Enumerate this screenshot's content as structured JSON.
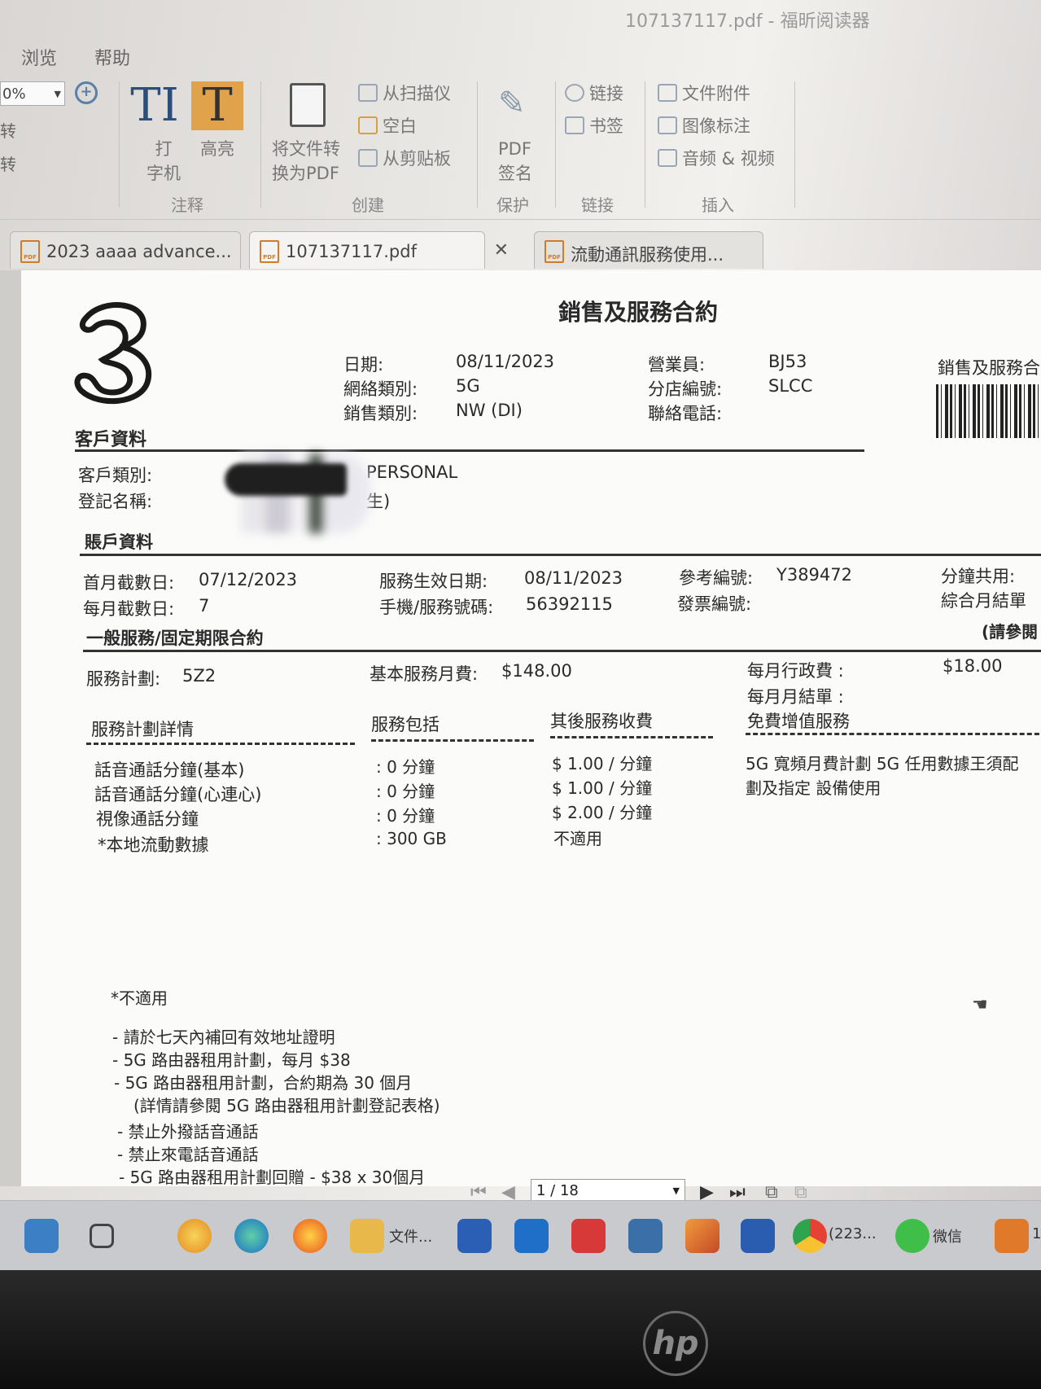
{
  "window": {
    "title": "107137117.pdf - 福昕阅读器"
  },
  "menu": {
    "items": [
      "浏览",
      "帮助"
    ]
  },
  "toolbar": {
    "zoom": "0%",
    "rotate_items": [
      "转",
      "转"
    ],
    "typewriter": [
      "打",
      "字机"
    ],
    "highlight": "高亮",
    "annotate_group": "注释",
    "convert": [
      "将文件转",
      "换为PDF"
    ],
    "create_items": [
      "从扫描仪",
      "空白",
      "从剪贴板"
    ],
    "create_group": "创建",
    "sign": [
      "PDF",
      "签名"
    ],
    "protect_group": "保护",
    "link_items": [
      "链接",
      "书签"
    ],
    "link_group": "链接",
    "insert_items": [
      "文件附件",
      "图像标注",
      "音频 & 视频"
    ],
    "insert_group": "插入"
  },
  "tabs": [
    {
      "label": "2023 aaaa advance..."
    },
    {
      "label": "107137117.pdf"
    },
    {
      "label": "流動通訊服務使用..."
    }
  ],
  "contract": {
    "title": "銷售及服務合約",
    "side_label": "銷售及服務合",
    "section_customer": "客戶資料",
    "date_label": "日期:",
    "date": "08/11/2023",
    "network_label": "網絡類別:",
    "network": "5G",
    "sales_type_label": "銷售類別:",
    "sales_type": "NW (DI)",
    "staff_label": "營業員:",
    "staff": "BJ53",
    "branch_label": "分店編號:",
    "branch": "SLCC",
    "phone_label": "聯絡電話:",
    "customer_type_label": "客戶類別:",
    "customer_type": "PERSONAL",
    "reg_name_label": "登記名稱:",
    "reg_name_suffix": "生)",
    "section_account": "賬戶資料",
    "first_cutoff_label": "首月截數日:",
    "first_cutoff": "07/12/2023",
    "monthly_cutoff_label": "每月截數日:",
    "monthly_cutoff": "7",
    "effective_label": "服務生效日期:",
    "effective": "08/11/2023",
    "mobile_label": "手機/服務號碼:",
    "mobile": "56392115",
    "ref_label": "參考編號:",
    "ref": "Y389472",
    "invoice_label": "發票編號:",
    "share_label": "分鐘共用:",
    "combined_label": "綜合月結單",
    "see_note": "(請參閱",
    "section_service": "一般服務/固定期限合約",
    "plan_label": "服務計劃:",
    "plan": "5Z2",
    "base_fee_label": "基本服務月費:",
    "base_fee": "$148.00",
    "admin_fee_label": "每月行政費 :",
    "admin_fee": "$18.00",
    "monthly_bill_label": "每月月結單 :",
    "col_details": "服務計劃詳情",
    "col_included": "服務包括",
    "col_after": "其後服務收費",
    "col_free": "免費增值服務",
    "rows": [
      {
        "item": "話音通話分鐘(基本)",
        "included": ": 0 分鐘",
        "after": "$ 1.00 / 分鐘"
      },
      {
        "item": "話音通話分鐘(心連心)",
        "included": ": 0 分鐘",
        "after": "$ 1.00 / 分鐘"
      },
      {
        "item": "視像通話分鐘",
        "included": ": 0 分鐘",
        "after": "$ 2.00 / 分鐘"
      },
      {
        "item": "*本地流動數據",
        "included": ": 300 GB",
        "after": "不適用"
      }
    ],
    "free_text": [
      "5G 寬頻月費計劃 5G 任用數據王須配",
      "劃及指定 設備使用"
    ],
    "na_note": "*不適用",
    "notes": [
      "- 請於七天內補回有效地址證明",
      "- 5G 路由器租用計劃，每月 $38",
      "- 5G 路由器租用計劃，合約期為 30 個月",
      "(詳情請參閱 5G 路由器租用計劃登記表格)",
      "- 禁止外撥話音通話",
      "- 禁止來電話音通話",
      "- 5G 路由器租用計劃回贈 - $38 x 30個月"
    ]
  },
  "pager": {
    "current": "1 / 18"
  },
  "taskbar": {
    "files_label": "文件...",
    "chrome_label": "(223...",
    "wechat_label": "微信",
    "foxit_label": "1"
  },
  "colors": {
    "highlight_icon": "#e0a24a",
    "foxit": "#e07a2a",
    "redact": "#2f3a2f"
  }
}
